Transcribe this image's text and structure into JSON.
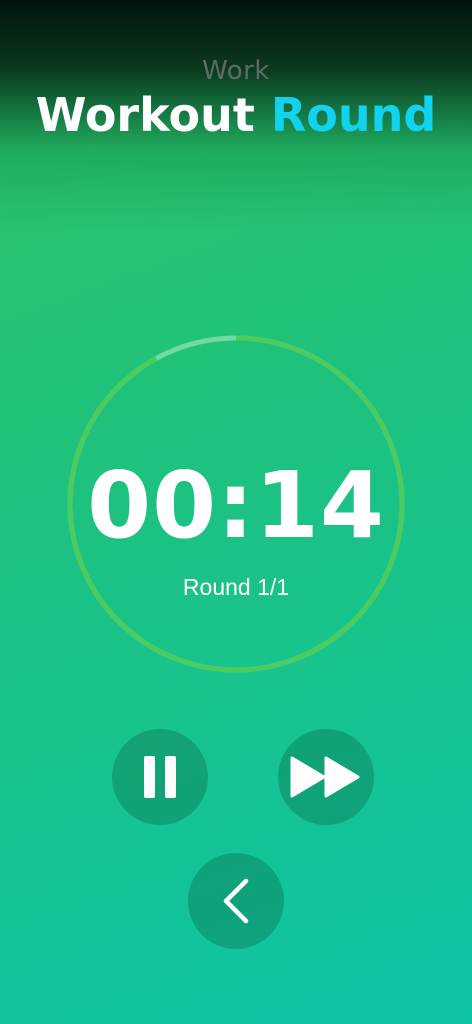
{
  "header": {
    "phase_label": "Work",
    "title_main": "Workout",
    "title_accent": "Round"
  },
  "timer": {
    "time": "00:14",
    "round_label": "Round 1/1",
    "progress": 0.92
  },
  "controls": {
    "pause_icon": "pause-icon",
    "skip_icon": "fast-forward-icon",
    "back_icon": "chevron-left-icon"
  },
  "colors": {
    "accent": "#11d3f0",
    "ring": "#4ccb5e",
    "ring_track": "#8fe0b0"
  }
}
